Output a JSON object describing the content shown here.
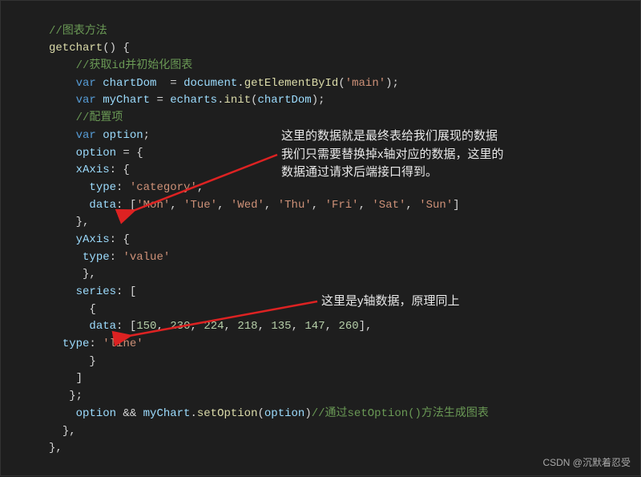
{
  "code": {
    "c1": "//图表方法",
    "l2a": "getchart",
    "l2b": "() {",
    "c2": "//获取id并初始化图表",
    "l4_var": "var",
    "l4_id": "chartDom",
    "l4_eq": "  = ",
    "l4_obj": "document",
    "l4_dot": ".",
    "l4_fn": "getElementById",
    "l4_op": "(",
    "l4_str": "'main'",
    "l4_cl": ");",
    "l5_var": "var",
    "l5_id": "myChart",
    "l5_eq": " = ",
    "l5_obj": "echarts",
    "l5_dot": ".",
    "l5_fn": "init",
    "l5_op": "(",
    "l5_arg": "chartDom",
    "l5_cl": ");",
    "c3": "//配置项",
    "l7_var": "var",
    "l7_id": "option",
    "l7_sc": ";",
    "l8_id": "option",
    "l8_eq": " = {",
    "l9_id": "xAxis",
    "l9_c": ": {",
    "l10_id": "type",
    "l10_c": ": ",
    "l10_v": "'category'",
    "l10_cm": ",",
    "l11_id": "data",
    "l11_c": ": [",
    "d1": "'Mon'",
    "cma": ", ",
    "d2": "'Tue'",
    "d3": "'Wed'",
    "d4": "'Thu'",
    "d5": "'Fri'",
    "d6": "'Sat'",
    "d7": "'Sun'",
    "l11_cl": "]",
    "l12": "},",
    "l13_id": "yAxis",
    "l13_c": ": {",
    "l14_id": "type",
    "l14_c": ": ",
    "l14_v": "'value'",
    "l15": "},",
    "l16_id": "series",
    "l16_c": ": [",
    "l17": "{",
    "l18_id": "data",
    "l18_c": ": [",
    "n1": "150",
    "n2": "230",
    "n3": "224",
    "n4": "218",
    "n5": "135",
    "n6": "147",
    "n7": "260",
    "l18_cl": "],",
    "l19_id": "type",
    "l19_c": ": ",
    "l19_v": "'line'",
    "l20": "}",
    "l21": "]",
    "l22": "};",
    "l23_a": "option",
    "l23_b": " && ",
    "l23_c": "myChart",
    "l23_d": ".",
    "l23_e": "setOption",
    "l23_f": "(",
    "l23_g": "option",
    "l23_h": ")",
    "c4": "//通过setOption()方法生成图表",
    "l24": "},",
    "l25": "},"
  },
  "annot": {
    "a1_l1": "这里的数据就是最终表给我们展现的数据",
    "a1_l2": "我们只需要替换掉x轴对应的数据，这里的",
    "a1_l3": "数据通过请求后端接口得到。",
    "a2": "这里是y轴数据，原理同上"
  },
  "watermark": "CSDN @沉默着忍受",
  "chart_data": {
    "type": "line",
    "categories": [
      "Mon",
      "Tue",
      "Wed",
      "Thu",
      "Fri",
      "Sat",
      "Sun"
    ],
    "values": [
      150,
      230,
      224,
      218,
      135,
      147,
      260
    ],
    "title": "",
    "xlabel": "",
    "ylabel": ""
  }
}
